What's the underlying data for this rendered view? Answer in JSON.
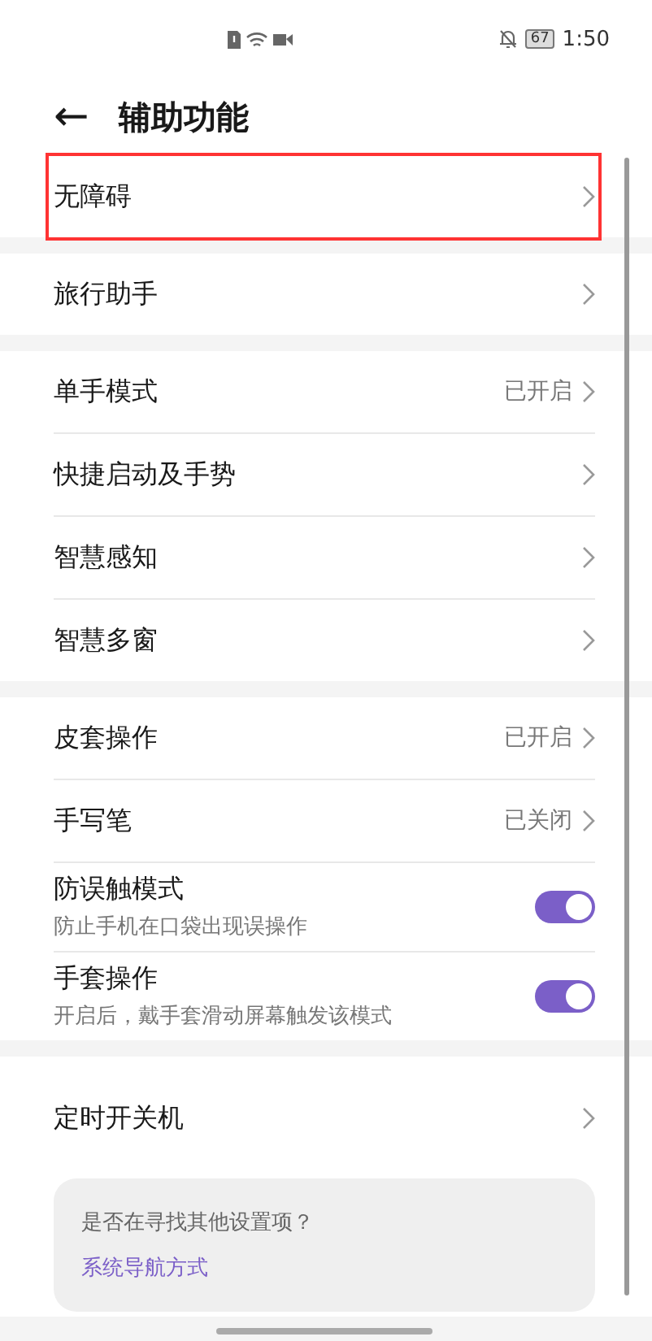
{
  "status_bar": {
    "battery": "67",
    "time": "1:50"
  },
  "header": {
    "back": "←",
    "title": "辅助功能"
  },
  "groups": [
    {
      "items": [
        {
          "kind": "link",
          "label": "无障碍",
          "highlighted": true
        }
      ]
    },
    {
      "items": [
        {
          "kind": "link",
          "label": "旅行助手",
          "highlighted": false
        }
      ]
    },
    {
      "items": [
        {
          "kind": "link",
          "label": "单手模式",
          "value": "已开启",
          "highlighted": false
        },
        {
          "kind": "link",
          "label": "快捷启动及手势",
          "highlighted": false
        },
        {
          "kind": "link",
          "label": "智慧感知",
          "highlighted": false
        },
        {
          "kind": "link",
          "label": "智慧多窗",
          "highlighted": false
        }
      ]
    },
    {
      "items": [
        {
          "kind": "link",
          "label": "皮套操作",
          "value": "已开启",
          "highlighted": false
        },
        {
          "kind": "link",
          "label": "手写笔",
          "value": "已关闭",
          "highlighted": false
        },
        {
          "kind": "toggle",
          "label": "防误触模式",
          "subtitle": "防止手机在口袋出现误操作",
          "on": true
        },
        {
          "kind": "toggle",
          "label": "手套操作",
          "subtitle": "开启后，戴手套滑动屏幕触发该模式",
          "on": true
        }
      ]
    },
    {
      "items": [
        {
          "kind": "link",
          "label": "定时开关机",
          "highlighted": false
        }
      ]
    }
  ],
  "suggestion": {
    "question": "是否在寻找其他设置项？",
    "link": "系统导航方式"
  }
}
